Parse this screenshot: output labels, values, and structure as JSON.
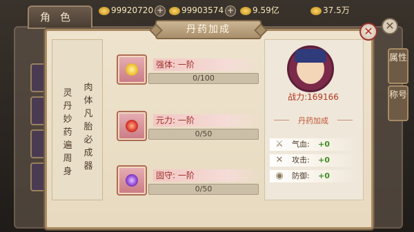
{
  "hud": {
    "tab_label": "角色",
    "res1": "99920720",
    "res2": "99903574",
    "res3": "9.59亿",
    "res4": "37.5万",
    "plus": "+"
  },
  "side_tabs": {
    "attr": "属性",
    "title": "称号"
  },
  "dialog": {
    "title": "丹药加成",
    "close": "✕",
    "left_text_1": "肉体凡胎必成器",
    "left_text_2": "灵丹妙药遍周身",
    "rows": [
      {
        "label": "强体: 一阶",
        "progress_text": "0/100",
        "current": 0,
        "max": 100,
        "pill_color": "#f1c232"
      },
      {
        "label": "元力: 一阶",
        "progress_text": "0/50",
        "current": 0,
        "max": 50,
        "pill_color": "#d9352b"
      },
      {
        "label": "固守: 一阶",
        "progress_text": "0/50",
        "current": 0,
        "max": 50,
        "pill_color": "#8a3fd1"
      }
    ],
    "power": "战力:169166",
    "section": "丹药加成",
    "stats": [
      {
        "name": "气血:",
        "value": "+0",
        "icon": "sword-icon"
      },
      {
        "name": "攻击:",
        "value": "+0",
        "icon": "crossed-swords-icon"
      },
      {
        "name": "防御:",
        "value": "+0",
        "icon": "shield-icon"
      }
    ]
  }
}
